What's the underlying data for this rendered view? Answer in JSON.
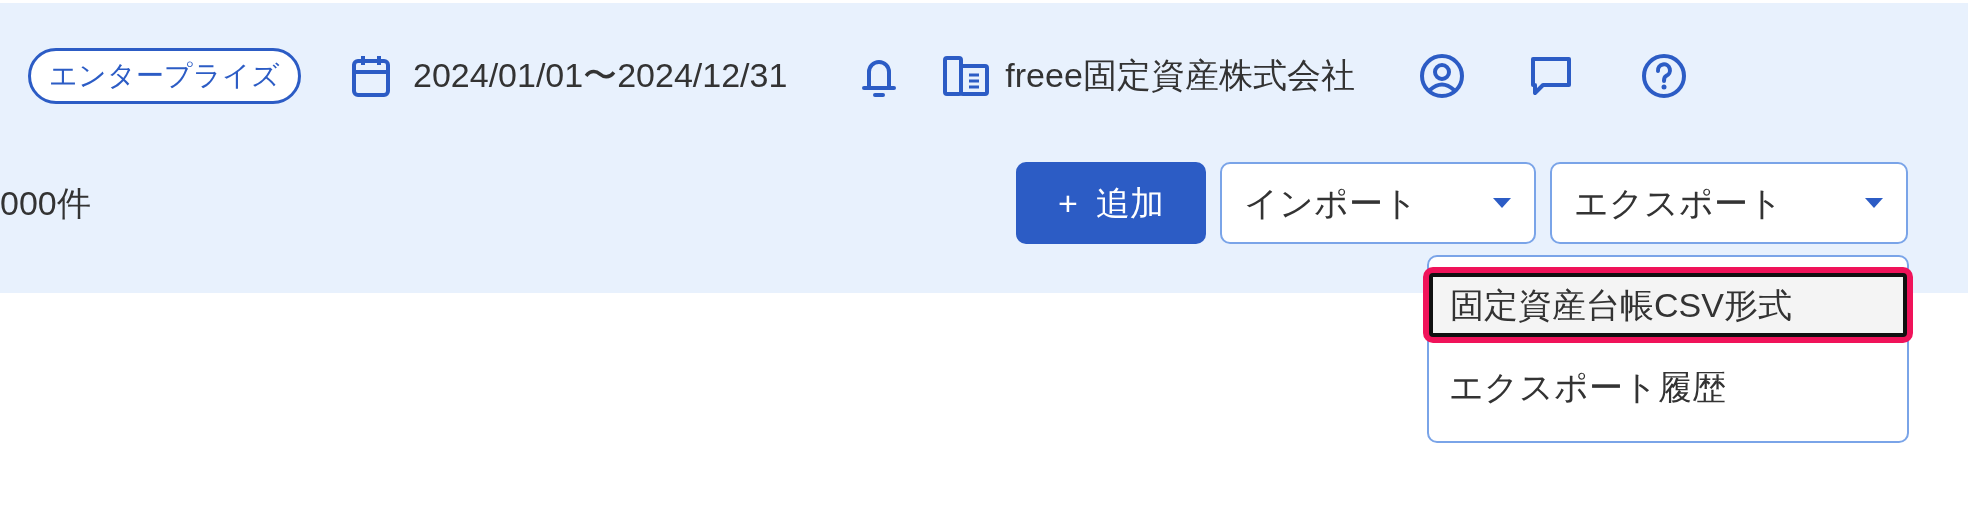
{
  "header": {
    "plan_badge": "エンタープライズ",
    "period": "2024/01/01〜2024/12/31",
    "company": "freee固定資産株式会社"
  },
  "toolbar": {
    "count": "000件",
    "add_button": {
      "icon": "+",
      "label": "追加"
    },
    "import_button": "インポート",
    "export_button": {
      "label": "エクスポート",
      "expanded": true
    }
  },
  "export_menu": [
    {
      "label": "固定資産台帳CSV形式",
      "selected": true
    },
    {
      "label": "エクスポート履歴",
      "selected": false
    }
  ]
}
